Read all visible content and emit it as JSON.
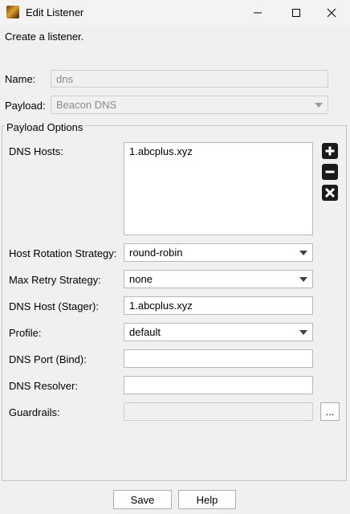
{
  "window": {
    "title": "Edit Listener",
    "controls": [
      "minimize-icon",
      "maximize-icon",
      "close-icon"
    ]
  },
  "header": {
    "description": "Create a listener."
  },
  "form": {
    "name_label": "Name:",
    "name_value": "dns",
    "payload_label": "Payload:",
    "payload_value": "Beacon DNS"
  },
  "options": {
    "group_title": "Payload Options",
    "dns_hosts_label": "DNS Hosts:",
    "dns_hosts": [
      "1.abcplus.xyz"
    ],
    "list_buttons": [
      "add-icon",
      "remove-icon",
      "clear-icon"
    ],
    "rotation_label": "Host Rotation Strategy:",
    "rotation_value": "round-robin",
    "retry_label": "Max Retry Strategy:",
    "retry_value": "none",
    "stager_label": "DNS Host (Stager):",
    "stager_value": "1.abcplus.xyz",
    "profile_label": "Profile:",
    "profile_value": "default",
    "port_label": "DNS Port (Bind):",
    "port_value": "",
    "resolver_label": "DNS Resolver:",
    "resolver_value": "",
    "guardrails_label": "Guardrails:",
    "guardrails_value": "",
    "guardrails_button": "..."
  },
  "footer": {
    "save_label": "Save",
    "help_label": "Help"
  }
}
